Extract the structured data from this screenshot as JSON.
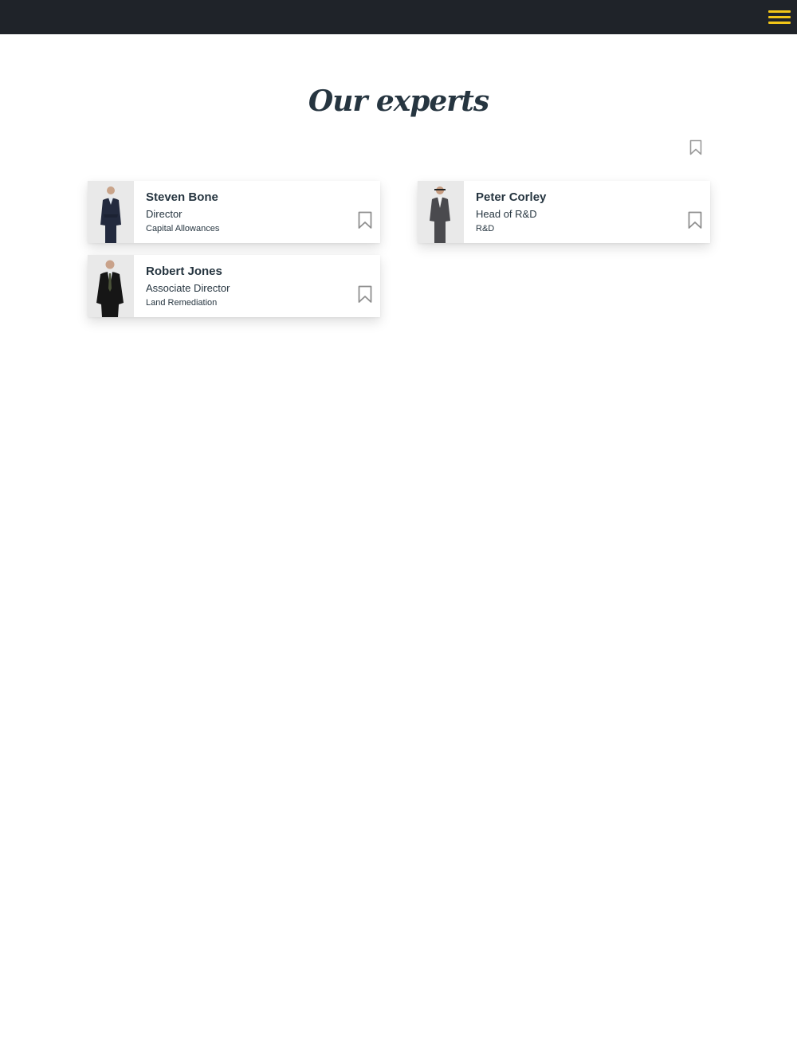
{
  "header": {
    "menu_icon": "hamburger-menu-icon",
    "menu_color": "#f2c618",
    "background": "#1f2329"
  },
  "main": {
    "title": "Our experts",
    "bookmark_icon": "bookmark-icon"
  },
  "experts": [
    {
      "name": "Steven Bone",
      "role": "Director",
      "department": "Capital Allowances"
    },
    {
      "name": "Peter Corley",
      "role": "Head of R&D",
      "department": "R&D"
    },
    {
      "name": "Robert Jones",
      "role": "Associate Director",
      "department": "Land Remediation"
    }
  ]
}
